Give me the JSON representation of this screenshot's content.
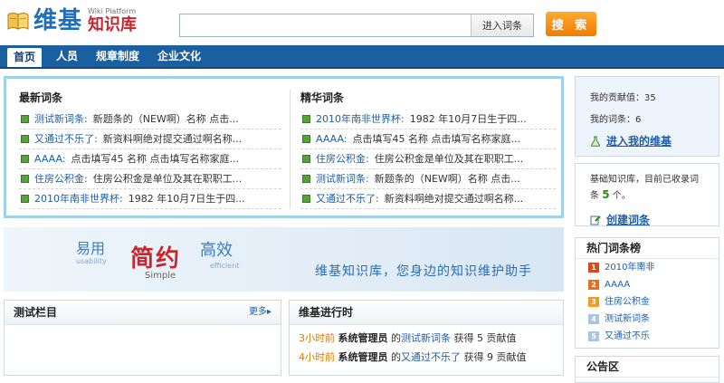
{
  "header": {
    "logo_main": "维基",
    "logo_sub_en": "Wiki Platform",
    "logo_sub_cn": "知识库",
    "search_value": "",
    "enter_label": "进入词条",
    "search_label": "搜 索"
  },
  "nav": {
    "items": [
      "首页",
      "人员",
      "规章制度",
      "企业文化"
    ],
    "active": 0
  },
  "latest": {
    "title": "最新词条",
    "items": [
      {
        "title": "测试新词条:",
        "desc": "新题条的（NEW啊）名称 点击..."
      },
      {
        "title": "又通过不乐了:",
        "desc": "新资料啊绝对提交通过啊名称..."
      },
      {
        "title": "AAAA:",
        "desc": "点击填写45 名称 点击填写名称家庭..."
      },
      {
        "title": "住房公积金:",
        "desc": "住房公积金是单位及其在职职工..."
      },
      {
        "title": "2010年南非世界杯:",
        "desc": "1982 年10月7日生于四..."
      }
    ]
  },
  "featured": {
    "title": "精华词条",
    "items": [
      {
        "title": "2010年南非世界杯:",
        "desc": "1982 年10月7日生于四..."
      },
      {
        "title": "AAAA:",
        "desc": "点击填写45 名称 点击填写名称家庭..."
      },
      {
        "title": "住房公积金:",
        "desc": "住房公积金是单位及其在职职工..."
      },
      {
        "title": "测试新词条:",
        "desc": "新题条的（NEW啊）名称 点击..."
      },
      {
        "title": "又通过不乐了:",
        "desc": "新资料啊绝对提交通过啊名称..."
      }
    ]
  },
  "side_stats": {
    "contribution": "我的贡献值：35",
    "entries": "我的词条：6",
    "link": "进入我的维基"
  },
  "side_kb": {
    "text_1": "基础知识库，目前已收录词",
    "text_2": "条",
    "count": "5",
    "text_3": "个。",
    "link": "创建词条"
  },
  "banner": {
    "yiyong": "易用",
    "usability": "usability",
    "jianyue": "简约",
    "simple": "Simple",
    "gaoxiao": "高效",
    "efficient": "efficient",
    "slogan": "维基知识库，您身边的知识维护助手"
  },
  "test_panel": {
    "title": "测试栏目",
    "more": "更多"
  },
  "activity": {
    "title": "维基进行时",
    "rows": [
      {
        "time": "3小时前",
        "user": "系统管理员",
        "mid": "的",
        "link": "测试新词条",
        "tail": "获得 5 贡献值"
      },
      {
        "time": "4小时前",
        "user": "系统管理员",
        "mid": "的",
        "link": "又通过不乐了",
        "tail": "获得 9 贡献值"
      }
    ]
  },
  "hot": {
    "title": "热门词条榜",
    "items": [
      {
        "rank": "1",
        "label": "2010年南非"
      },
      {
        "rank": "2",
        "label": "AAAA"
      },
      {
        "rank": "3",
        "label": "住房公积金"
      },
      {
        "rank": "4",
        "label": "测试新词条"
      },
      {
        "rank": "5",
        "label": "又通过不乐"
      }
    ],
    "rank_colors": [
      "#d9481f",
      "#e8701c",
      "#ef9a2b",
      "#a8c6e2",
      "#a8c6e2"
    ]
  },
  "notice": {
    "title": "公告区"
  }
}
